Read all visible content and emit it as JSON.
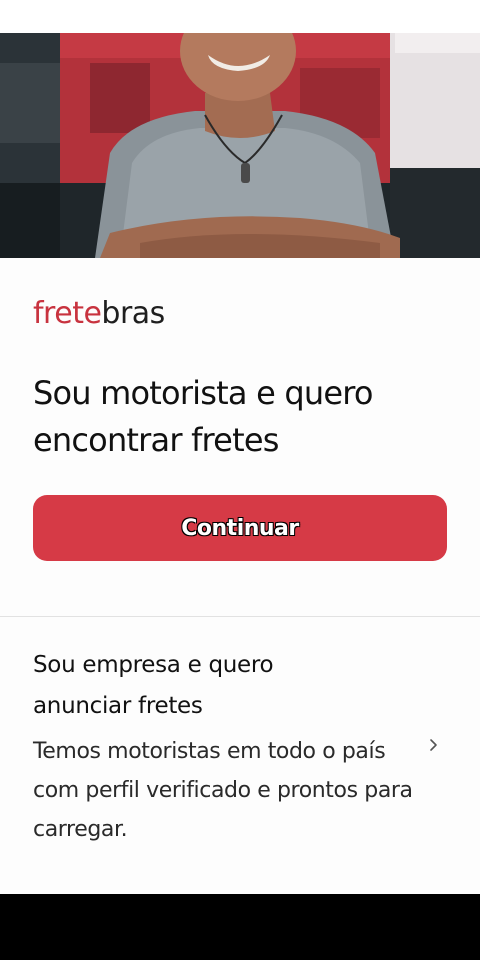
{
  "logo": {
    "part1": "frete",
    "part2": "bras"
  },
  "driver_section": {
    "headline": "Sou motorista e quero encontrar fretes",
    "continue_label": "Continuar"
  },
  "company_section": {
    "title": "Sou empresa e quero anunciar fretes",
    "description": "Temos motoristas em todo o país com perfil verificado e prontos para carregar."
  },
  "colors": {
    "brand": "#c8333f",
    "button": "#d63a46"
  },
  "icons": {
    "company_arrow": "chevron-right-icon"
  }
}
